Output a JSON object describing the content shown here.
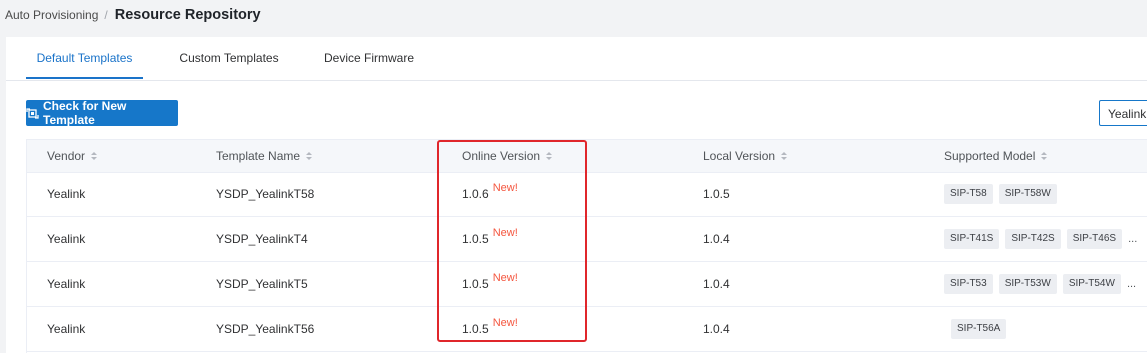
{
  "breadcrumb": {
    "parent": "Auto Provisioning",
    "separator": "/",
    "current": "Resource Repository"
  },
  "tabs": [
    {
      "label": "Default Templates",
      "active": true
    },
    {
      "label": "Custom Templates",
      "active": false
    },
    {
      "label": "Device Firmware",
      "active": false
    }
  ],
  "toolbar": {
    "check_label": "Check for New Template",
    "check_icon": "refresh-chip-icon",
    "filter_value": "Yealink"
  },
  "table": {
    "columns": [
      "Vendor",
      "Template Name",
      "Online Version",
      "Local Version",
      "Supported Model"
    ],
    "new_label": "New!",
    "more_label": "...",
    "rows": [
      {
        "vendor": "Yealink",
        "template_name": "YSDP_YealinkT58",
        "online_version": "1.0.6",
        "is_new": true,
        "local_version": "1.0.5",
        "models": [
          "SIP-T58",
          "SIP-T58W"
        ],
        "more": false
      },
      {
        "vendor": "Yealink",
        "template_name": "YSDP_YealinkT4",
        "online_version": "1.0.5",
        "is_new": true,
        "local_version": "1.0.4",
        "models": [
          "SIP-T41S",
          "SIP-T42S",
          "SIP-T46S"
        ],
        "more": true
      },
      {
        "vendor": "Yealink",
        "template_name": "YSDP_YealinkT5",
        "online_version": "1.0.5",
        "is_new": true,
        "local_version": "1.0.4",
        "models": [
          "SIP-T53",
          "SIP-T53W",
          "SIP-T54W"
        ],
        "more": true
      },
      {
        "vendor": "Yealink",
        "template_name": "YSDP_YealinkT56",
        "online_version": "1.0.5",
        "is_new": true,
        "local_version": "1.0.4",
        "models": [
          "SIP-T56A"
        ],
        "more": false
      }
    ]
  },
  "colors": {
    "accent": "#1677c9",
    "new_badge": "#f4563f",
    "highlight": "#e0262b"
  }
}
